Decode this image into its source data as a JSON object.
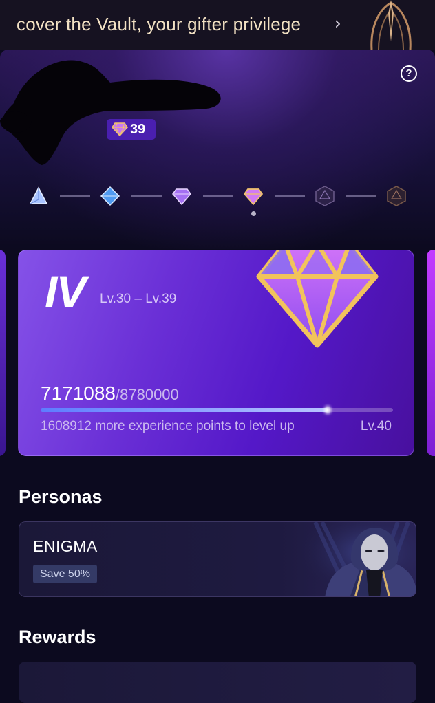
{
  "banner": {
    "text": "cover the Vault, your gifter privilege",
    "chevron_icon": "chevron-right-icon",
    "art_icon": "vault-ornament-icon"
  },
  "header": {
    "help_icon": "question-circle-icon",
    "help_glyph": "?",
    "gem_count": "39",
    "gem_icon": "diamond-gem-icon"
  },
  "tiers": {
    "items": [
      {
        "icon": "tier-1-crystal-icon",
        "state": "unlocked",
        "color": "#8fb4ff"
      },
      {
        "icon": "tier-2-crystal-icon",
        "state": "unlocked",
        "color": "#5aa4f2"
      },
      {
        "icon": "tier-3-diamond-icon",
        "state": "unlocked",
        "color": "#b07af5"
      },
      {
        "icon": "tier-4-diamond-icon",
        "state": "current",
        "color": "#e9b04a"
      },
      {
        "icon": "tier-5-hexagon-icon",
        "state": "locked",
        "color": "#4b3b6a"
      },
      {
        "icon": "tier-6-hexagon-icon",
        "state": "locked",
        "color": "#5a4140"
      }
    ],
    "current_index": 3
  },
  "level_card": {
    "tier": "IV",
    "range": "Lv.30 – Lv.39",
    "xp_current": "7171088",
    "xp_total": "/8780000",
    "progress": 0.817,
    "note": "1608912 more experience points to level up",
    "next_level": "Lv.40",
    "gem_icon": "tier-diamond-icon"
  },
  "personas": {
    "title": "Personas",
    "card": {
      "name": "ENIGMA",
      "badge": "Save 50%",
      "art_icon": "masked-hooded-figure-icon"
    }
  },
  "rewards": {
    "title": "Rewards"
  },
  "colors": {
    "background": "#0c0a1f",
    "accent_purple": "#6a2fd6",
    "gold": "#e9b04a",
    "badge_purple": "#4a1fb0"
  }
}
